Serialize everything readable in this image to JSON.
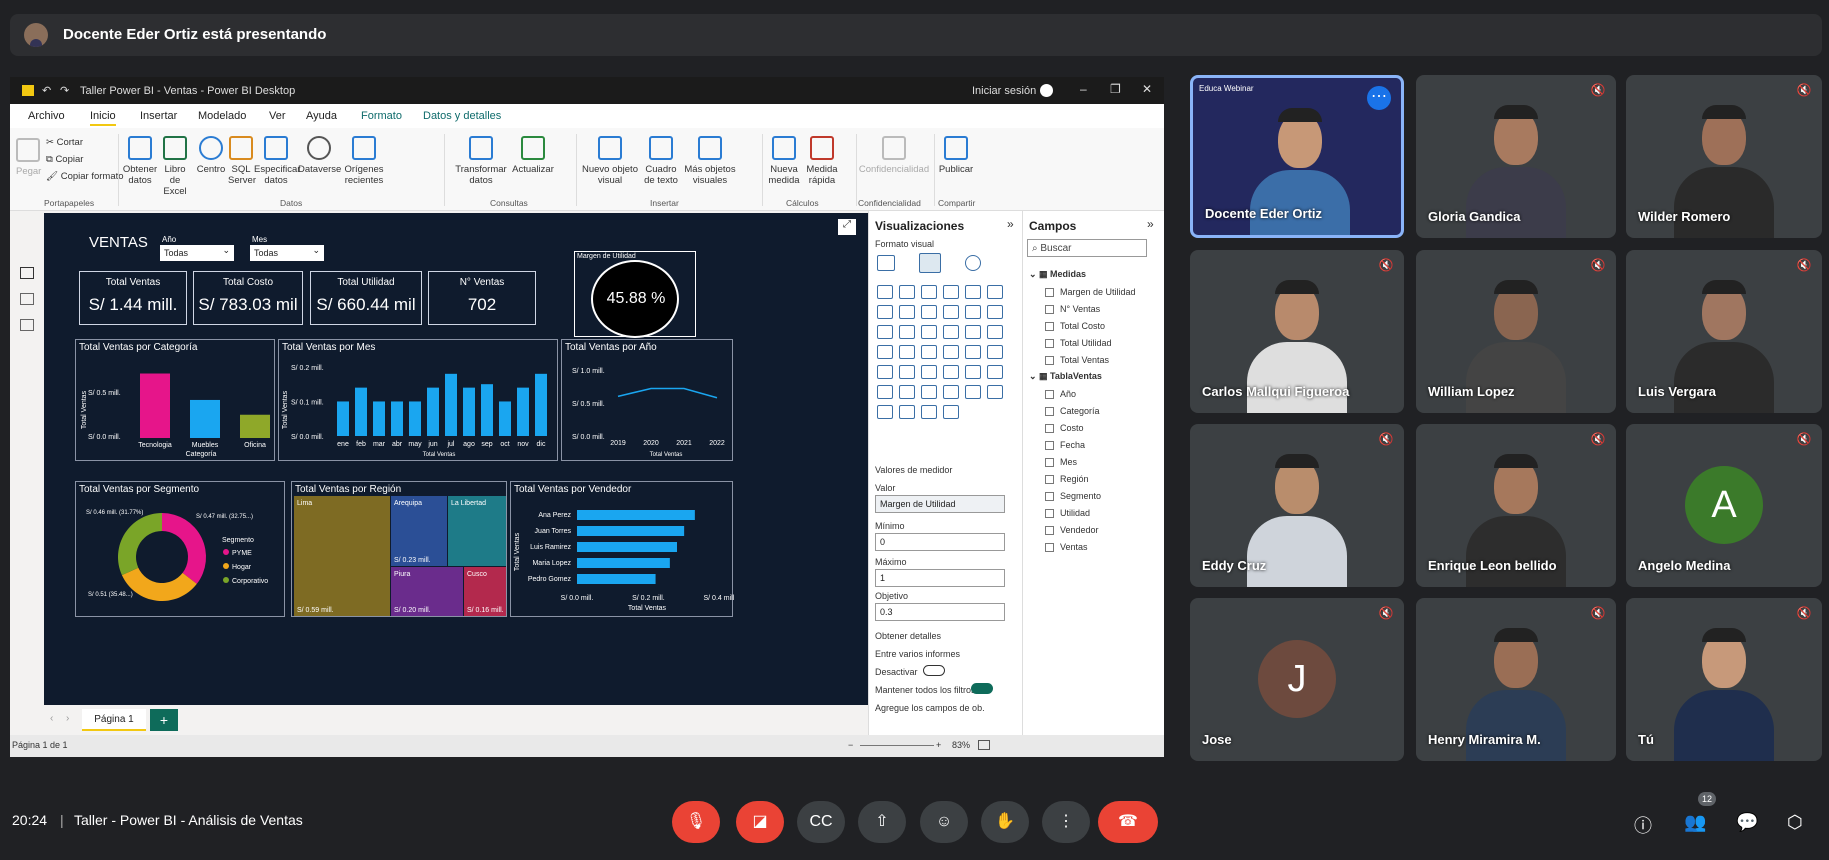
{
  "banner": {
    "text": "Docente Eder Ortiz está presentando"
  },
  "pbi": {
    "title": "Taller Power BI - Ventas - Power BI Desktop",
    "signin": "Iniciar sesión",
    "tabs": [
      "Archivo",
      "Inicio",
      "Insertar",
      "Modelado",
      "Ver",
      "Ayuda",
      "Formato",
      "Datos y detalles"
    ],
    "ribbon": {
      "pegar": "Pegar",
      "cortar": "Cortar",
      "copiar": "Copiar",
      "copiar_formato": "Copiar formato",
      "obtener": "Obtener datos",
      "libro": "Libro de Excel",
      "centro": "Centro",
      "sql": "SQL Server",
      "especificar": "Especificar datos",
      "dataverse": "Dataverse",
      "origenes": "Orígenes recientes",
      "transformar": "Transformar datos",
      "actualizar": "Actualizar",
      "nuevo_visual": "Nuevo objeto visual",
      "cuadro": "Cuadro de texto",
      "mas_objetos": "Más objetos visuales",
      "nueva_medida": "Nueva medida",
      "medida_rapida": "Medida rápida",
      "confidencialidad": "Confidencialidad",
      "publicar": "Publicar",
      "g_porta": "Portapapeles",
      "g_datos": "Datos",
      "g_consultas": "Consultas",
      "g_insertar": "Insertar",
      "g_calculos": "Cálculos",
      "g_conf": "Confidencialidad",
      "g_compartir": "Compartir"
    },
    "report": {
      "title": "VENTAS",
      "slicer_ano_label": "Año",
      "slicer_ano_value": "Todas",
      "slicer_mes_label": "Mes",
      "slicer_mes_value": "Todas",
      "cards": [
        {
          "label": "Total Ventas",
          "value": "S/ 1.44 mill."
        },
        {
          "label": "Total Costo",
          "value": "S/ 783.03 mil"
        },
        {
          "label": "Total Utilidad",
          "value": "S/ 660.44 mil"
        },
        {
          "label": "N° Ventas",
          "value": "702"
        }
      ],
      "gauge_title": "Margen de Utilidad",
      "gauge_value": "45.88 %",
      "cat_title": "Total Ventas por Categoría",
      "cat_ylabel": "Total Ventas",
      "cat_xlabel": "Categoría",
      "cat_ticks": [
        "S/ 0.5 mill.",
        "S/ 0.0 mill."
      ],
      "mes_title": "Total Ventas por Mes",
      "mes_ylabel": "Total Ventas",
      "mes_xlabel": "Total Ventas",
      "mes_ticks": [
        "S/ 0.2 mill.",
        "S/ 0.1 mill.",
        "S/ 0.0 mill."
      ],
      "ano_title": "Total Ventas por Año",
      "ano_xlabel": "Total Ventas",
      "ano_ticks": [
        "S/ 1.0 mill.",
        "S/ 0.5 mill.",
        "S/ 0.0 mill."
      ],
      "seg_title": "Total Ventas por Segmento",
      "seg_legend_title": "Segmento",
      "seg_labels": [
        "S/ 0.46 mill. (31.77%)",
        "S/ 0.47 mill. (32.75...)",
        "S/ 0.51 (35.48...)"
      ],
      "reg_title": "Total Ventas por Región",
      "ven_title": "Total Ventas por Vendedor",
      "ven_ylabel": "Total Ventas",
      "ven_xlabel": "Total Ventas",
      "ven_ticks": [
        "S/ 0.0 mill.",
        "S/ 0.2 mill.",
        "S/ 0.4 mill."
      ]
    },
    "page_tab": "Página 1",
    "status": "Página 1 de 1",
    "zoom": "83%"
  },
  "viz_pane": {
    "title": "Visualizaciones",
    "subtitle": "Formato visual",
    "valores": "Valores de medidor",
    "valor": "Valor",
    "valor_field": "Margen de Utilidad",
    "minimo": "Mínimo",
    "minimo_v": "0",
    "maximo": "Máximo",
    "maximo_v": "1",
    "objetivo": "Objetivo",
    "objetivo_v": "0.3",
    "obtener": "Obtener detalles",
    "entre": "Entre varios informes",
    "desactivar": "Desactivar",
    "mantener": "Mantener todos los filtros",
    "agregue": "Agregue los campos de ob..."
  },
  "fields_pane": {
    "title": "Campos",
    "search": "Buscar",
    "medidas": "Medidas",
    "medidas_items": [
      "Margen de Utilidad",
      "N° Ventas",
      "Total Costo",
      "Total Utilidad",
      "Total Ventas"
    ],
    "tabla": "TablaVentas",
    "tabla_items": [
      "Año",
      "Categoría",
      "Costo",
      "Fecha",
      "Mes",
      "Región",
      "Segmento",
      "Utilidad",
      "Vendedor",
      "Ventas"
    ]
  },
  "participants": [
    {
      "name": "Docente Eder Ortiz"
    },
    {
      "name": "Gloria Gandica"
    },
    {
      "name": "Wilder Romero"
    },
    {
      "name": "Carlos Mallqui Figueroa"
    },
    {
      "name": "William Lopez"
    },
    {
      "name": "Luis Vergara"
    },
    {
      "name": "Eddy Cruz"
    },
    {
      "name": "Enrique Leon bellido"
    },
    {
      "name": "Angelo Medina",
      "letter": "A",
      "color": "#3b7a2a"
    },
    {
      "name": "Jose",
      "letter": "J",
      "color": "#6d4a3e"
    },
    {
      "name": "Henry Miramira M."
    },
    {
      "name": "Tú"
    }
  ],
  "tile_brand": "Educa Webinar",
  "bottom": {
    "time": "20:24",
    "meeting": "Taller - Power BI - Análisis de Ventas",
    "people_count": "12"
  },
  "chart_data": [
    {
      "type": "bar",
      "title": "Total Ventas por Categoría",
      "categories": [
        "Tecnologia",
        "Muebles",
        "Oficina"
      ],
      "values": [
        0.61,
        0.36,
        0.22
      ],
      "colors": [
        "#e6158a",
        "#1aa6f0",
        "#8fa829"
      ],
      "ylabel": "Total Ventas",
      "xlabel": "Categoría",
      "unit": "S/ mill."
    },
    {
      "type": "bar",
      "title": "Total Ventas por Mes",
      "categories": [
        "ene",
        "feb",
        "mar",
        "abr",
        "may",
        "jun",
        "jul",
        "ago",
        "sep",
        "oct",
        "nov",
        "dic"
      ],
      "values": [
        0.1,
        0.14,
        0.1,
        0.1,
        0.1,
        0.14,
        0.18,
        0.14,
        0.15,
        0.1,
        0.14,
        0.18
      ],
      "ylabel": "Total Ventas",
      "xlabel": "Total Ventas",
      "unit": "S/ mill."
    },
    {
      "type": "line",
      "title": "Total Ventas por Año",
      "x": [
        "2019",
        "2020",
        "2021",
        "2022"
      ],
      "values": [
        0.6,
        0.72,
        0.72,
        0.58
      ],
      "xlabel": "Total Ventas",
      "unit": "S/ mill."
    },
    {
      "type": "pie",
      "title": "Total Ventas por Segmento",
      "categories": [
        "PYME",
        "Hogar",
        "Corporativo"
      ],
      "values": [
        35.48,
        32.75,
        31.77
      ],
      "colors": [
        "#e6158a",
        "#f2a71b",
        "#7aa528"
      ],
      "unit": "%"
    },
    {
      "type": "treemap",
      "title": "Total Ventas por Región",
      "categories": [
        "Lima",
        "Arequipa",
        "La Libertad",
        "Piura",
        "Cusco"
      ],
      "labels": [
        "S/ 0.59 mill.",
        "S/ 0.23 mill.",
        "",
        "S/ 0.20 mill.",
        "S/ 0.16 mill."
      ],
      "values": [
        0.59,
        0.23,
        0.21,
        0.2,
        0.16
      ],
      "colors": [
        "#7e6b23",
        "#2b4f96",
        "#1e7b88",
        "#6a2c8c",
        "#b3294d"
      ]
    },
    {
      "type": "bar",
      "orientation": "horizontal",
      "title": "Total Ventas por Vendedor",
      "categories": [
        "Ana Perez",
        "Juan Torres",
        "Luis Ramirez",
        "Maria Lopez",
        "Pedro Gomez"
      ],
      "values": [
        0.33,
        0.3,
        0.28,
        0.26,
        0.22
      ],
      "xlim": [
        0,
        0.4
      ],
      "unit": "S/ mill."
    }
  ]
}
